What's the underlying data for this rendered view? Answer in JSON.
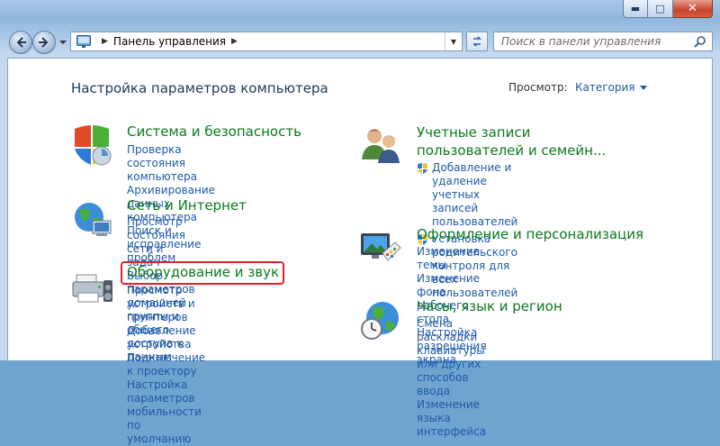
{
  "window": {
    "minimize_icon": "minimize-icon",
    "maximize_icon": "maximize-icon",
    "close_icon": "close-icon"
  },
  "toolbar": {
    "address_root": "Панель управления",
    "search_placeholder": "Поиск в панели управления"
  },
  "main": {
    "heading": "Настройка параметров компьютера",
    "view_by_label": "Просмотр:",
    "view_by_value": "Категория"
  },
  "categories": [
    {
      "title": "Система и безопасность",
      "links": [
        "Проверка состояния компьютера",
        "Архивирование данных компьютера",
        "Поиск и исправление проблем"
      ]
    },
    {
      "title": "Сеть и Интернет",
      "links": [
        "Просмотр состояния сети и задач",
        "Выбор параметров домашней группы и",
        "общего доступа к данным"
      ]
    },
    {
      "title": "Оборудование и звук",
      "links": [
        "Просмотр устройств и принтеров",
        "Добавление устройства",
        "Подключение к проектору",
        "Настройка параметров мобильности по",
        "умолчанию"
      ]
    },
    {
      "title": "Учетные записи пользователей и семейн...",
      "links": [
        "Добавление и удаление учетных записей",
        "пользователей",
        "Установка родительского контроля для",
        "всех пользователей"
      ]
    },
    {
      "title": "Оформление и персонализация",
      "links": [
        "Изменение темы",
        "Изменение фона рабочего стола",
        "Настройка разрешения экрана"
      ]
    },
    {
      "title": "Часы, язык и регион",
      "links": [
        "Смена раскладки клавиатуры или других",
        "способов ввода",
        "Изменение языка интерфейса"
      ]
    }
  ],
  "colors": {
    "category_title": "#0a7a1b",
    "link": "#1e5aa8",
    "heading": "#1e395b",
    "highlight": "#d8242a"
  }
}
